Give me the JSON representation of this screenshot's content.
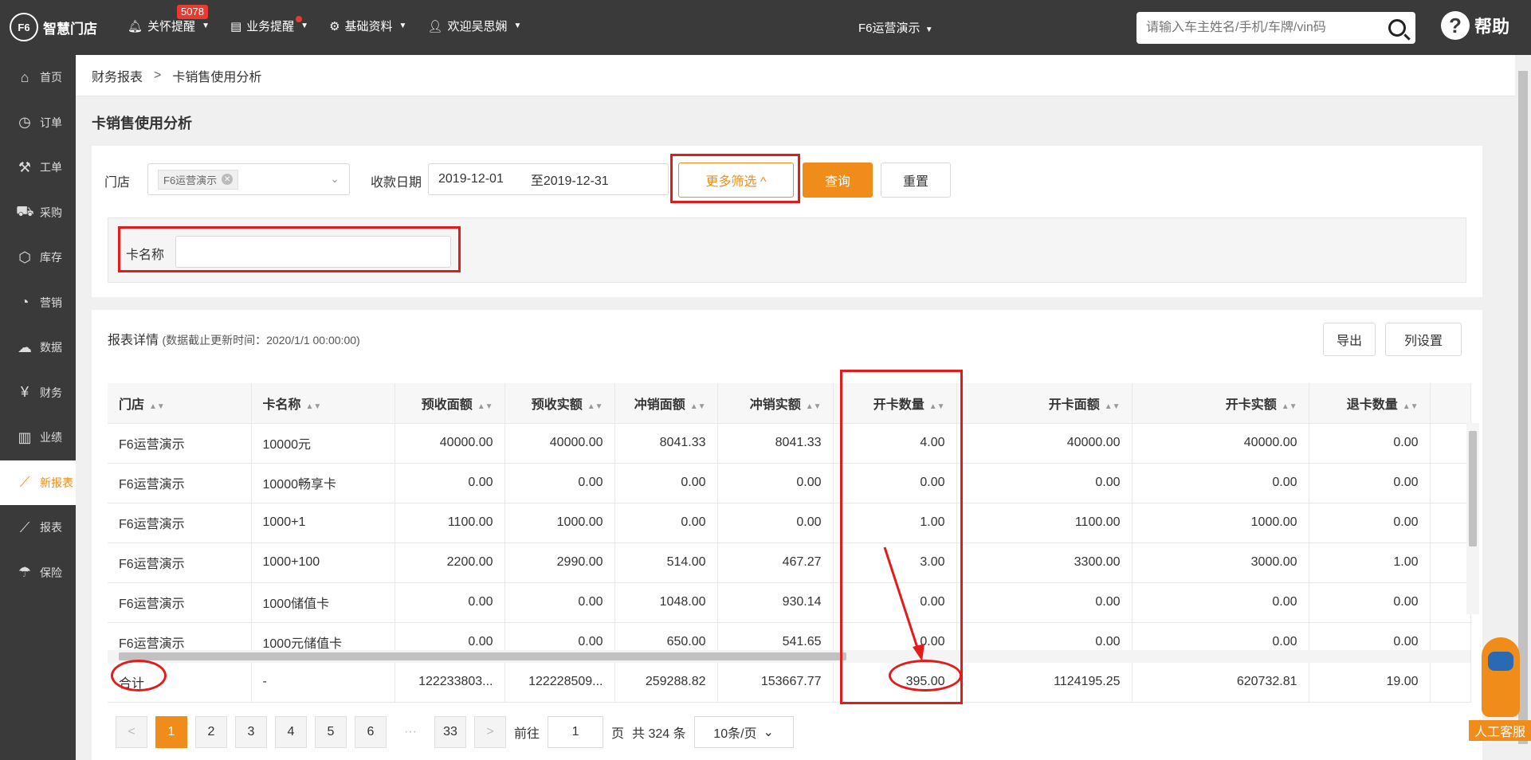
{
  "app": {
    "logo_mark": "F6",
    "name": "智慧门店"
  },
  "topnav": {
    "care": {
      "label": "关怀提醒",
      "badge": "5078"
    },
    "business": {
      "label": "业务提醒"
    },
    "basic": {
      "label": "基础资料"
    },
    "user": {
      "label": "欢迎吴思娴"
    },
    "store": {
      "label": "F6运营演示"
    }
  },
  "search": {
    "placeholder": "请输入车主姓名/手机/车牌/vin码"
  },
  "help": {
    "label": "帮助"
  },
  "sidebar": {
    "items": [
      {
        "label": "首页",
        "icon": "home-icon",
        "glyph": "⌂"
      },
      {
        "label": "订单",
        "icon": "clock-icon",
        "glyph": "◷"
      },
      {
        "label": "工单",
        "icon": "wrench-icon",
        "glyph": "⚒"
      },
      {
        "label": "采购",
        "icon": "cart-icon",
        "glyph": "⛟"
      },
      {
        "label": "库存",
        "icon": "box-icon",
        "glyph": "⬡"
      },
      {
        "label": "营销",
        "icon": "pie-icon",
        "glyph": "◔"
      },
      {
        "label": "数据",
        "icon": "cloud-icon",
        "glyph": "☁"
      },
      {
        "label": "财务",
        "icon": "yen-icon",
        "glyph": "¥"
      },
      {
        "label": "业绩",
        "icon": "bar-chart-icon",
        "glyph": "▥"
      },
      {
        "label": "新报表",
        "icon": "line-chart-icon",
        "glyph": "⟋"
      },
      {
        "label": "报表",
        "icon": "line-chart-icon",
        "glyph": "⟋"
      },
      {
        "label": "保险",
        "icon": "umbrella-icon",
        "glyph": "☂"
      }
    ]
  },
  "breadcrumb": {
    "parent": "财务报表",
    "current": "卡销售使用分析"
  },
  "page": {
    "title": "卡销售使用分析"
  },
  "filter": {
    "store_label": "门店",
    "store_tag": "F6运营演示",
    "date_label": "收款日期",
    "date_start": "2019-12-01",
    "date_end": "至2019-12-31",
    "more_label": "更多筛选 ^",
    "query_label": "查询",
    "reset_label": "重置",
    "card_name_label": "卡名称",
    "card_name_value": ""
  },
  "report": {
    "title": "报表详情",
    "subtitle": "(数据截止更新时间：2020/1/1 00:00:00)",
    "export_label": "导出",
    "columns_label": "列设置",
    "headers": [
      "门店",
      "卡名称",
      "预收面额",
      "预收实额",
      "冲销面额",
      "冲销实额",
      "开卡数量",
      "开卡面额",
      "开卡实额",
      "退卡数量"
    ],
    "rows": [
      [
        "F6运营演示",
        "10000元",
        "40000.00",
        "40000.00",
        "8041.33",
        "8041.33",
        "4.00",
        "40000.00",
        "40000.00",
        "0.00"
      ],
      [
        "F6运营演示",
        "10000畅享卡",
        "0.00",
        "0.00",
        "0.00",
        "0.00",
        "0.00",
        "0.00",
        "0.00",
        "0.00"
      ],
      [
        "F6运营演示",
        "1000+1",
        "1100.00",
        "1000.00",
        "0.00",
        "0.00",
        "1.00",
        "1100.00",
        "1000.00",
        "0.00"
      ],
      [
        "F6运营演示",
        "1000+100",
        "2200.00",
        "2990.00",
        "514.00",
        "467.27",
        "3.00",
        "3300.00",
        "3000.00",
        "1.00"
      ],
      [
        "F6运营演示",
        "1000储值卡",
        "0.00",
        "0.00",
        "1048.00",
        "930.14",
        "0.00",
        "0.00",
        "0.00",
        "0.00"
      ],
      [
        "F6运营演示",
        "1000元储值卡",
        "0.00",
        "0.00",
        "650.00",
        "541.65",
        "0.00",
        "0.00",
        "0.00",
        "0.00"
      ]
    ],
    "total": [
      "合计",
      "-",
      "122233803...",
      "122228509...",
      "259288.82",
      "153667.77",
      "395.00",
      "1124195.25",
      "620732.81",
      "19.00"
    ]
  },
  "pagination": {
    "pages": [
      "1",
      "2",
      "3",
      "4",
      "5",
      "6",
      "···",
      "33"
    ],
    "goto_label": "前往",
    "goto_value": "1",
    "page_unit": "页",
    "total_text": "共 324 条",
    "page_size": "10条/页"
  },
  "support": {
    "label": "人工客服"
  }
}
